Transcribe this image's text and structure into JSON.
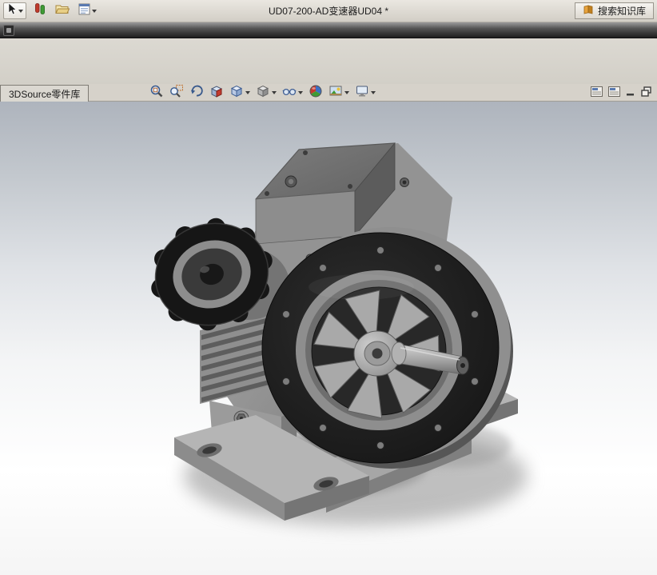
{
  "titlebar": {
    "title": "UD07-200-AD变速器UD04 *",
    "tools": [
      {
        "name": "select-tool",
        "icon": "cursor-arrow-icon",
        "has_dropdown": true
      },
      {
        "name": "component-tool",
        "icon": "red-green-pins-icon"
      },
      {
        "name": "open-document-tool",
        "icon": "folder-icon"
      },
      {
        "name": "properties-tool",
        "icon": "form-icon",
        "has_dropdown": true
      }
    ],
    "search_button": {
      "label": "搜索知识库",
      "icon": "knowledge-book-icon"
    }
  },
  "menu_band": {
    "icon": "collapsed-menu-icon"
  },
  "library_tab": {
    "label": "3DSource零件库"
  },
  "heads_up_toolbar": {
    "icons": [
      {
        "name": "zoom-to-fit-icon"
      },
      {
        "name": "zoom-to-area-icon"
      },
      {
        "name": "previous-view-icon"
      },
      {
        "name": "section-view-icon"
      },
      {
        "name": "view-orientation-icon",
        "has_dropdown": true
      },
      {
        "name": "display-style-icon",
        "has_dropdown": true
      },
      {
        "name": "hide-show-items-icon",
        "has_dropdown": true
      },
      {
        "name": "edit-appearance-icon"
      },
      {
        "name": "apply-scene-icon",
        "has_dropdown": true
      },
      {
        "name": "view-settings-icon",
        "has_dropdown": true
      }
    ]
  },
  "document_window_controls": {
    "icons": [
      {
        "name": "doc-window-icon-1"
      },
      {
        "name": "doc-window-icon-2"
      },
      {
        "name": "minimize-icon"
      },
      {
        "name": "restore-icon"
      }
    ]
  },
  "viewport": {
    "content": "3d-model-worm-gear-reducer-with-cooling-fan",
    "background_top": "#aeb4bd",
    "background_bottom": "#ffffff"
  },
  "colors": {
    "chrome": "#d6d2ca",
    "dark_band": "#2a2a2a",
    "accent_orange": "#e8a33d",
    "model_face_black": "#1c1c1c",
    "model_gray": "#9a9a9a"
  }
}
